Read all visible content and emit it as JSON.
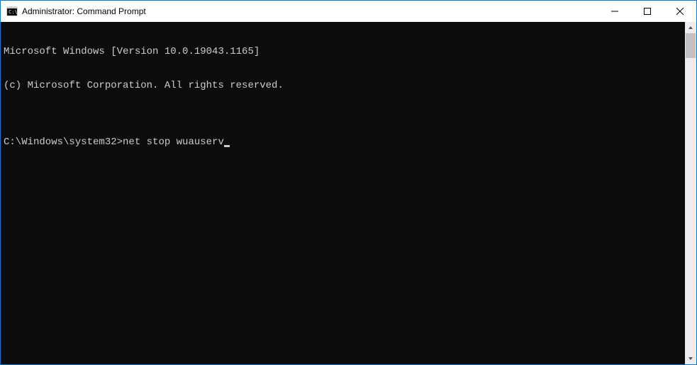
{
  "window": {
    "title": "Administrator: Command Prompt"
  },
  "console": {
    "line1": "Microsoft Windows [Version 10.0.19043.1165]",
    "line2": "(c) Microsoft Corporation. All rights reserved.",
    "blank": "",
    "prompt": "C:\\Windows\\system32>",
    "command": "net stop wuauserv"
  }
}
